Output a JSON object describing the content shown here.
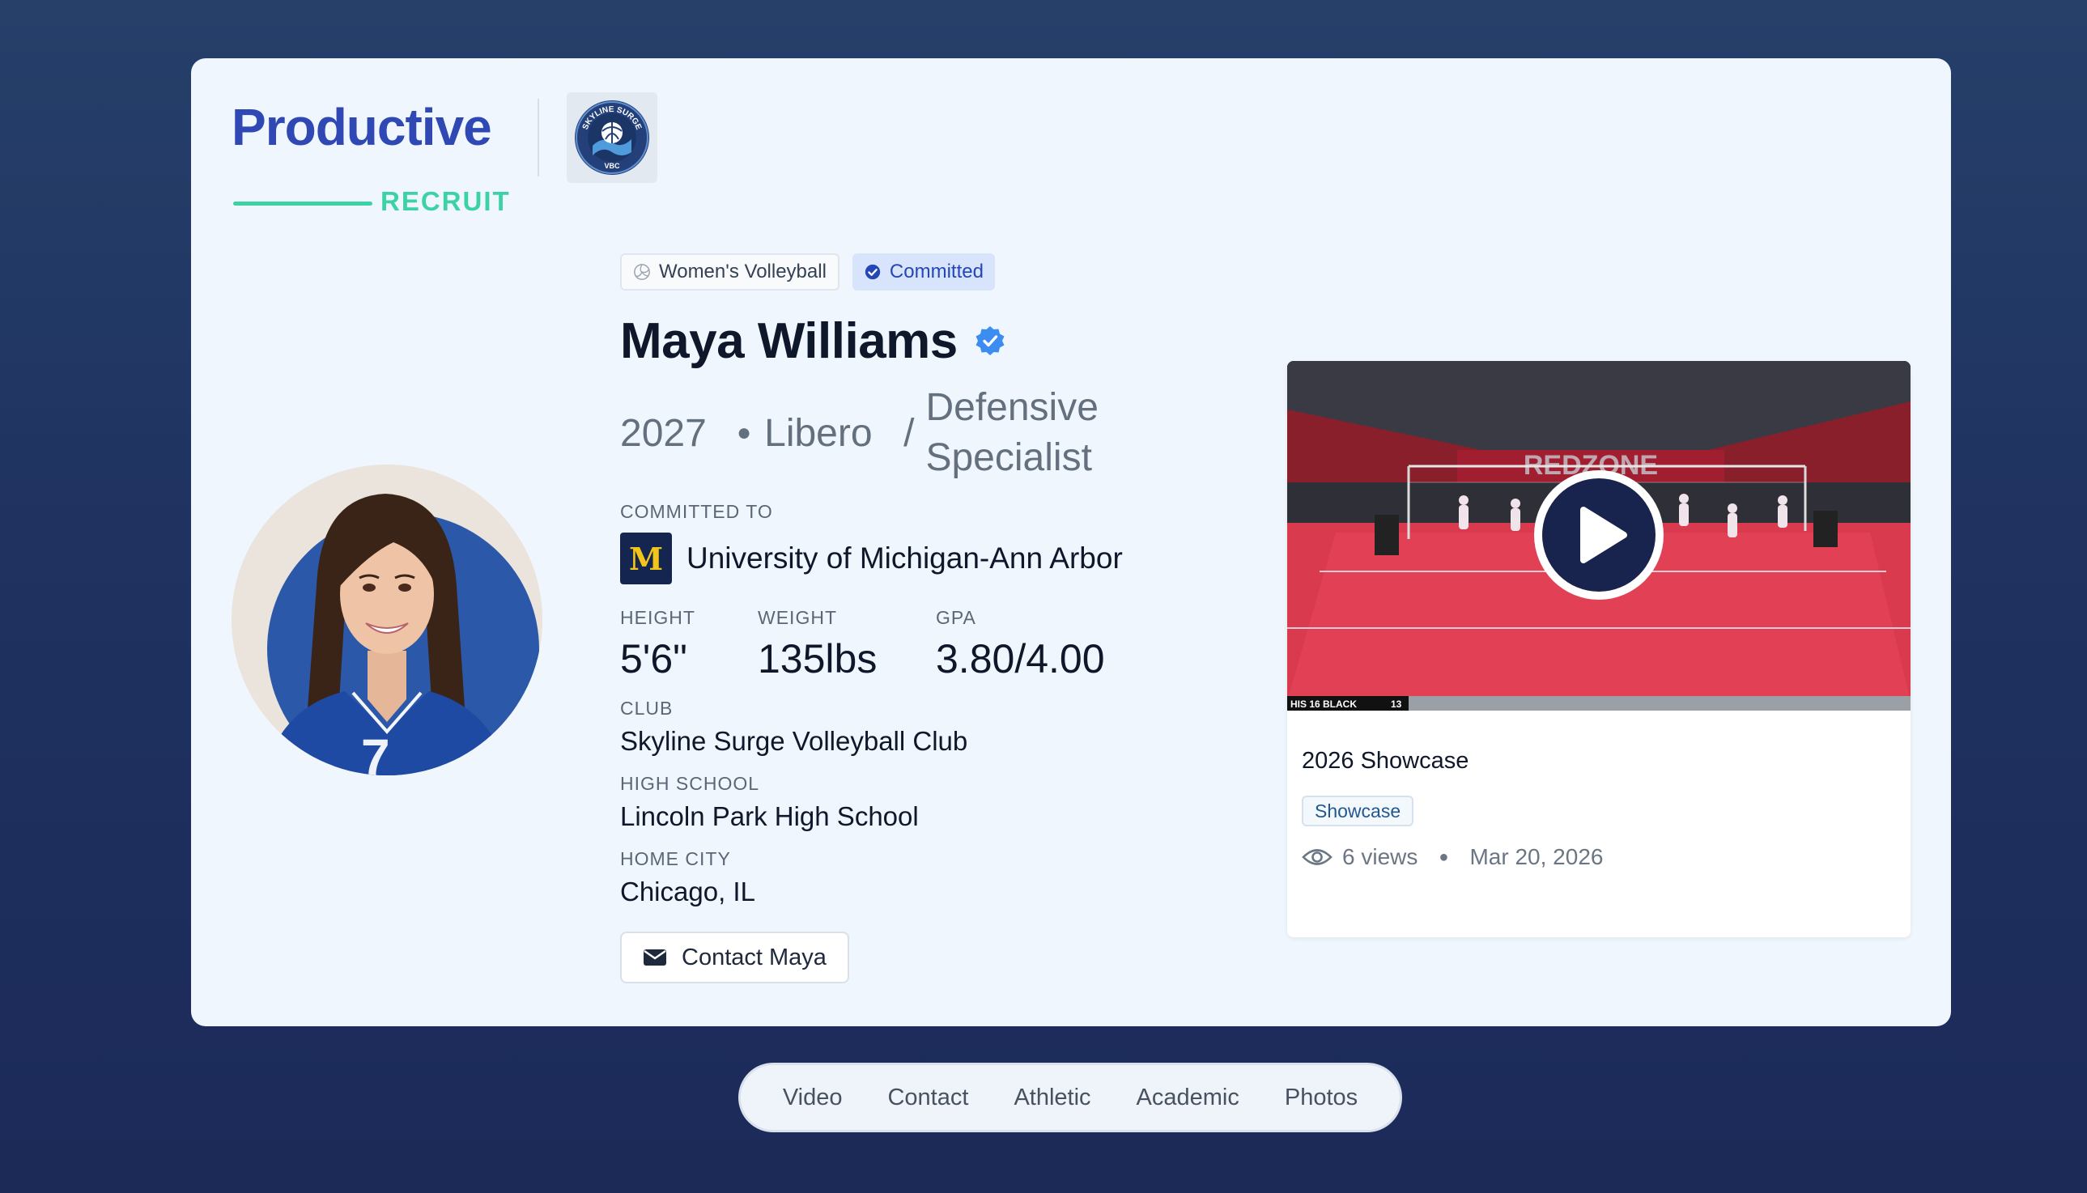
{
  "brand": {
    "name": "Productive",
    "sub": "RECRUIT",
    "primary_color": "#3048b3",
    "accent_color": "#3dd2a6"
  },
  "club_logo": {
    "text_top": "SKYLINE SURGE",
    "text_bottom": "VBC"
  },
  "profile": {
    "sport": "Women's Volleyball",
    "status": "Committed",
    "name": "Maya Williams",
    "year": "2027",
    "position": "Libero",
    "position_slash": "/",
    "position_alt_line1": "Defensive",
    "position_alt_line2": "Specialist",
    "committed_label": "COMMITTED TO",
    "university": "University of Michigan-Ann Arbor",
    "university_logo_letter": "M",
    "jersey_number": "7",
    "stats": {
      "height_label": "HEIGHT",
      "height": "5'6\"",
      "weight_label": "WEIGHT",
      "weight": "135lbs",
      "gpa_label": "GPA",
      "gpa": "3.80/4.00"
    },
    "club_label": "CLUB",
    "club": "Skyline Surge Volleyball Club",
    "high_school_label": "HIGH SCHOOL",
    "high_school": "Lincoln Park High School",
    "home_city_label": "HOME CITY",
    "home_city": "Chicago, IL",
    "contact_label": "Contact Maya"
  },
  "video": {
    "title": "2026 Showcase",
    "tag": "Showcase",
    "views": "6 views",
    "date": "Mar 20, 2026",
    "banner_text": "REDZONE",
    "scoreboard_text": "HIS 16 BLACK",
    "scoreboard_score": "13"
  },
  "nav": {
    "items": [
      "Video",
      "Contact",
      "Athletic",
      "Academic",
      "Photos"
    ]
  }
}
